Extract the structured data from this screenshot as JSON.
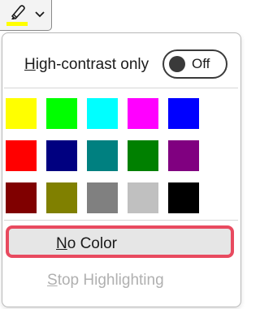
{
  "highlighter_button": {
    "icon": "highlighter-pen-icon",
    "current_color": "#FFFF00",
    "dropdown_icon": "chevron-down-icon"
  },
  "high_contrast": {
    "label_first": "H",
    "label_rest": "igh-contrast only",
    "toggle_state": "Off"
  },
  "swatches": [
    {
      "name": "yellow",
      "color": "#FFFF00"
    },
    {
      "name": "bright-green",
      "color": "#00FF00"
    },
    {
      "name": "turquoise",
      "color": "#00FFFF"
    },
    {
      "name": "pink",
      "color": "#FF00FF"
    },
    {
      "name": "blue",
      "color": "#0000FF"
    },
    {
      "name": "red",
      "color": "#FF0000"
    },
    {
      "name": "dark-blue",
      "color": "#000080"
    },
    {
      "name": "teal",
      "color": "#008080"
    },
    {
      "name": "green",
      "color": "#008000"
    },
    {
      "name": "violet",
      "color": "#800080"
    },
    {
      "name": "dark-red",
      "color": "#800000"
    },
    {
      "name": "dark-yellow",
      "color": "#808000"
    },
    {
      "name": "gray-50",
      "color": "#808080"
    },
    {
      "name": "gray-25",
      "color": "#C0C0C0"
    },
    {
      "name": "black",
      "color": "#000000"
    }
  ],
  "no_color": {
    "label_first": "N",
    "label_rest": "o Color",
    "highlight_color": "#E84A5F"
  },
  "stop_highlighting": {
    "label_first": "S",
    "label_rest": "top Highlighting",
    "enabled": false
  }
}
